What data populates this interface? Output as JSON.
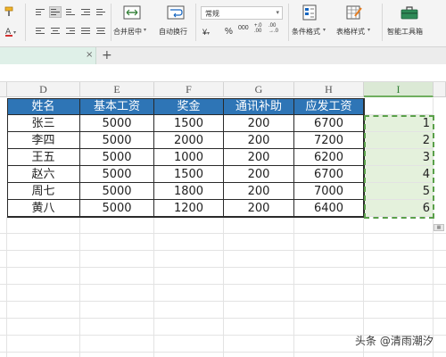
{
  "ribbon": {
    "merge_center_label": "合并居中",
    "wrap_text_label": "自动换行",
    "number_format_value": "常规",
    "currency_symbol": "¥",
    "percent_symbol": "%",
    "conditional_format_label": "条件格式",
    "table_style_label": "表格样式",
    "smart_toolbox_label": "智能工具箱"
  },
  "columns": [
    "D",
    "E",
    "F",
    "G",
    "H",
    "I"
  ],
  "table": {
    "headers": [
      "姓名",
      "基本工资",
      "奖金",
      "通讯补助",
      "应发工资"
    ],
    "rows": [
      [
        "张三",
        "5000",
        "1500",
        "200",
        "6700",
        "1"
      ],
      [
        "李四",
        "5000",
        "2000",
        "200",
        "7200",
        "2"
      ],
      [
        "王五",
        "5000",
        "1000",
        "200",
        "6200",
        "3"
      ],
      [
        "赵六",
        "5000",
        "1500",
        "200",
        "6700",
        "4"
      ],
      [
        "周七",
        "5000",
        "1800",
        "200",
        "7000",
        "5"
      ],
      [
        "黄八",
        "5000",
        "1200",
        "200",
        "6400",
        "6"
      ]
    ]
  },
  "watermark": "头条 @清雨潮汐",
  "colors": {
    "header_fill": "#2e75b6",
    "selection_fill": "#e4f1dc",
    "selection_border": "#5aa04a"
  }
}
